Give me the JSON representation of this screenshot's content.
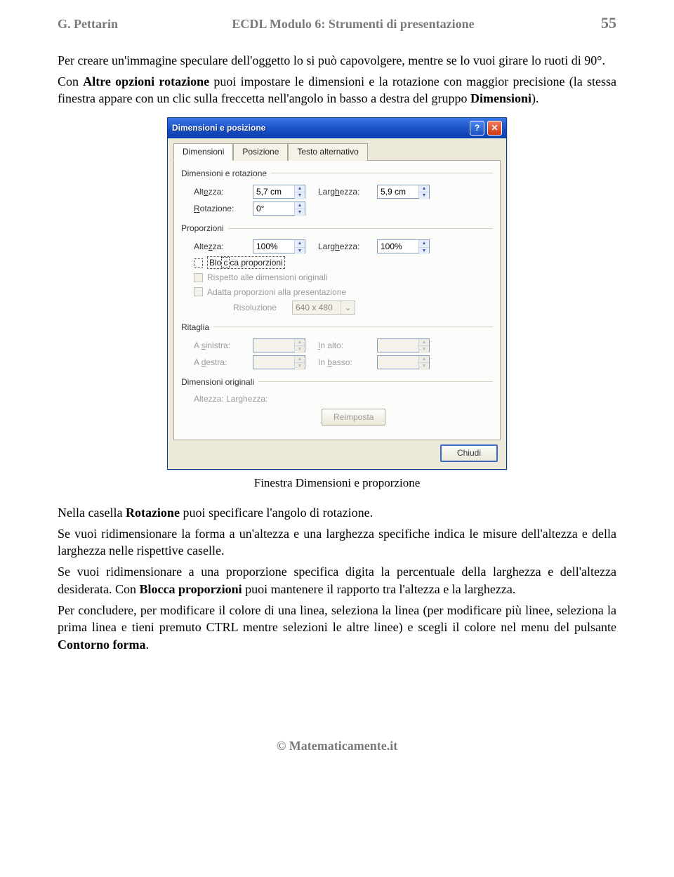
{
  "header": {
    "author": "G. Pettarin",
    "title": "ECDL Modulo 6: Strumenti di presentazione",
    "page_number": "55"
  },
  "paragraphs": {
    "p1a": "Per creare un'immagine speculare dell'oggetto lo si può capovolgere, mentre se lo vuoi girare lo ruoti di 90°.",
    "p1b_pre": "Con ",
    "p1b_b": "Altre opzioni rotazione",
    "p1b_post": " puoi impostare le dimensioni e la rotazione con maggior precisione (la stessa finestra appare con un clic sulla freccetta nell'angolo in basso a destra del gruppo ",
    "p1b_b2": "Dimensioni",
    "p1b_tail": ").",
    "p2_pre": "Nella casella ",
    "p2_b": "Rotazione",
    "p2_post": " puoi specificare l'angolo di rotazione.",
    "p3": "Se vuoi ridimensionare la forma a un'altezza e una larghezza specifiche indica le misure dell'altezza e della larghezza nelle rispettive caselle.",
    "p4_pre": "Se vuoi ridimensionare a una proporzione specifica digita la percentuale della larghezza e dell'altezza desiderata. Con ",
    "p4_b": "Blocca proporzioni",
    "p4_post": " puoi mantenere il rapporto tra l'altezza e la larghezza.",
    "p5_pre": "Per concludere, per modificare il  colore di una linea, seleziona la linea (per modificare più linee, seleziona la prima linea e tieni premuto CTRL mentre selezioni le altre linee) e scegli il colore nel menu del pulsante ",
    "p5_b": "Contorno forma",
    "p5_tail": "."
  },
  "caption": "Finestra Dimensioni e proporzione",
  "dialog": {
    "title": "Dimensioni e posizione",
    "tabs": [
      "Dimensioni",
      "Posizione",
      "Testo alternativo"
    ],
    "group_dim_rot": "Dimensioni e rotazione",
    "altezza_label": "Altezza:",
    "altezza_value": "5,7 cm",
    "larghezza_label": "Larghezza:",
    "larghezza_value": "5,9 cm",
    "rotazione_label": "Rotazione:",
    "rotazione_value": "0°",
    "group_prop": "Proporzioni",
    "prop_altezza_value": "100%",
    "prop_larghezza_value": "100%",
    "chk_blocca": "Blocca proporzioni",
    "chk_rispetto": "Rispetto alle dimensioni originali",
    "chk_adatta": "Adatta proporzioni alla presentazione",
    "risoluzione_label": "Risoluzione",
    "risoluzione_value": "640 x 480",
    "group_ritaglia": "Ritaglia",
    "a_sinistra": "A sinistra:",
    "in_alto": "In alto:",
    "a_destra": "A destra:",
    "in_basso": "In basso:",
    "group_orig": "Dimensioni originali",
    "orig_text": "Altezza:   Larghezza:",
    "reimposta": "Reimposta",
    "chiudi": "Chiudi"
  },
  "footer": "© Matematicamente.it"
}
